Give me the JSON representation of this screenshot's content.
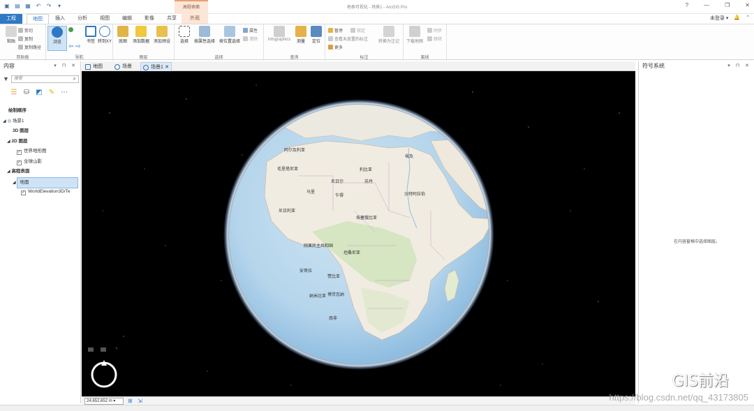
{
  "app": {
    "title": "地表可视化 - 场景1 - ArcGIS Pro",
    "context_group": "高程表面",
    "window_controls": [
      "?",
      "—",
      "❐",
      "✕"
    ]
  },
  "tabs": [
    "工程",
    "地图",
    "插入",
    "分析",
    "视图",
    "编辑",
    "影像",
    "共享",
    "外观"
  ],
  "user": {
    "name": "未登录 ▾",
    "bell": "🔔",
    "expand": "⌃"
  },
  "ribbon": {
    "clipboard": {
      "label": "剪贴板",
      "paste": "粘贴",
      "cut": "剪切",
      "copy": "复制",
      "copy_path": "复制路径"
    },
    "navigate": {
      "label": "导航",
      "explore": "浏览",
      "bookmarks": "书签",
      "goto_xy": "转到XY"
    },
    "layer": {
      "label": "图层",
      "basemap": "底图",
      "add_data": "添加数据",
      "add_preset": "添加预设"
    },
    "selection": {
      "label": "选择",
      "select": "选择",
      "by_attr": "按属性选择",
      "by_loc": "按位置选择",
      "attributes": "属性",
      "clear": "清除"
    },
    "inquiry": {
      "label": "查询",
      "infographics": "Infographics",
      "measure": "测量",
      "locate": "定位"
    },
    "labeling": {
      "label": "标注",
      "pause": "暂停",
      "lock": "锁定",
      "view_unplaced": "查看未放置的标注",
      "more": "更多",
      "convert": "转换为注记"
    },
    "offline": {
      "label": "离线",
      "download": "下载地图",
      "sync": "同步",
      "remove": "移除"
    }
  },
  "contents": {
    "title": "内容",
    "search_placeholder": "搜索",
    "tree": {
      "draw_order": "绘制顺序",
      "scene": "场景1",
      "layers_3d": "3D 图层",
      "layers_2d": "2D 图层",
      "world_topo": "世界地形图",
      "hillshade": "全球山影",
      "elevation_surfaces": "高程表面",
      "ground": "地面",
      "world_elevation": "WorldElevation3D/Te"
    }
  },
  "view_tabs": [
    "地图",
    "场景",
    "场景1"
  ],
  "map_labels": {
    "mauritania": "毛里塔尼亚",
    "mali": "马里",
    "niger": "尼日尔",
    "chad": "乍得",
    "sudan": "苏丹",
    "egypt": "埃及",
    "libya": "利比亚",
    "algeria": "阿尔及利亚",
    "nigeria": "尼日利亚",
    "ethiopia": "埃塞俄比亚",
    "drc": "刚果民主共和国",
    "tanzania": "坦桑尼亚",
    "angola": "安哥拉",
    "zambia": "赞比亚",
    "namibia": "纳米比亚",
    "botswana": "博茨瓦纳",
    "south_africa": "南非",
    "saudi": "沙特阿拉伯"
  },
  "status": {
    "scale": "24,652,652 m"
  },
  "symbology": {
    "title": "符号系统",
    "empty_message": "在内容窗格中选择图层。"
  },
  "watermark": {
    "text": "GIS前沿",
    "url": "https://blog.csdn.net/qq_43173805"
  }
}
